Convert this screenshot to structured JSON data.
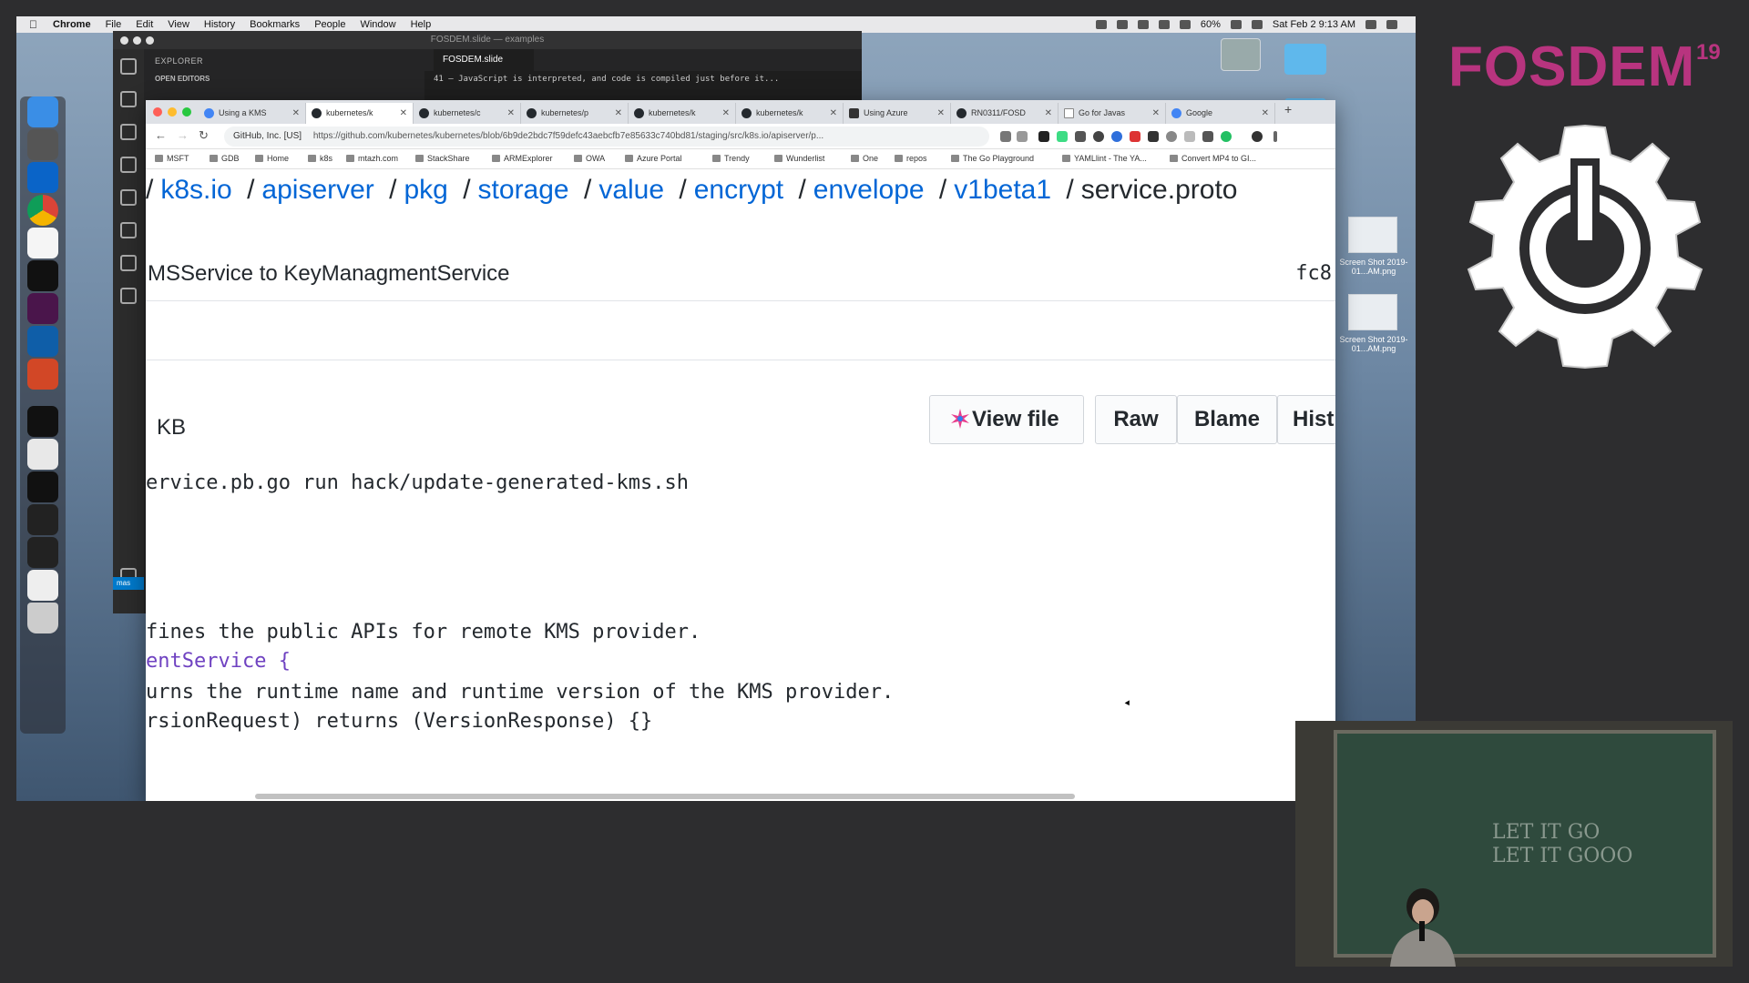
{
  "macos": {
    "menu": [
      "Chrome",
      "File",
      "Edit",
      "View",
      "History",
      "Bookmarks",
      "People",
      "Window",
      "Help"
    ],
    "battery": "60%",
    "clock": "Sat Feb 2  9:13 AM"
  },
  "vscode": {
    "title": "FOSDEM.slide — examples",
    "explorer_header": "EXPLORER",
    "open_editors": "OPEN EDITORS",
    "tab": "FOSDEM.slide",
    "code_line": "41    — JavaScript is interpreted, and code is compiled just before it...",
    "status": "mas"
  },
  "chrome": {
    "tabs": [
      "Using a KMS",
      "kubernetes/k",
      "kubernetes/c",
      "kubernetes/p",
      "kubernetes/k",
      "kubernetes/k",
      "Using Azure",
      "RN0311/FOSD",
      "Go for Javas",
      "Google"
    ],
    "site_identity": "GitHub, Inc. [US]",
    "url": "https://github.com/kubernetes/kubernetes/blob/6b9de2bdc7f59defc43aebcfb7e85633c740bd81/staging/src/k8s.io/apiserver/p...",
    "bookmarks": [
      "MSFT",
      "GDB",
      "Home",
      "k8s",
      "mtazh.com",
      "StackShare",
      "ARMExplorer",
      "OWA",
      "Azure Portal",
      "Trendy",
      "Wunderlist",
      "One",
      "repos",
      "The Go Playground",
      "YAMLlint - The YA...",
      "Convert MP4 to GI..."
    ]
  },
  "github": {
    "breadcrumb": [
      "k8s.io",
      "apiserver",
      "pkg",
      "storage",
      "value",
      "encrypt",
      "envelope",
      "v1beta1"
    ],
    "current_file": "service.proto",
    "commit_message": "MSService to KeyManagmentService",
    "commit_sha": "fc8",
    "size": "KB",
    "buttons": {
      "view": "View file",
      "raw": "Raw",
      "blame": "Blame",
      "history": "Hist"
    },
    "code_lines": [
      "ervice.pb.go run hack/update-generated-kms.sh",
      "fines the public APIs for remote KMS provider.",
      "entService {",
      "urns the runtime name and runtime version of the KMS provider.",
      "rsionRequest) returns (VersionResponse) {}"
    ]
  },
  "desktop": {
    "screenshot_1": "Screen Shot 2019-01...AM.png",
    "screenshot_2": "Screen Shot 2019-01...AM.png"
  },
  "branding": {
    "name": "FOSDEM",
    "year": "19"
  },
  "webcam": {
    "board_lines": [
      "LET IT GO",
      "LET IT GOOO"
    ]
  }
}
